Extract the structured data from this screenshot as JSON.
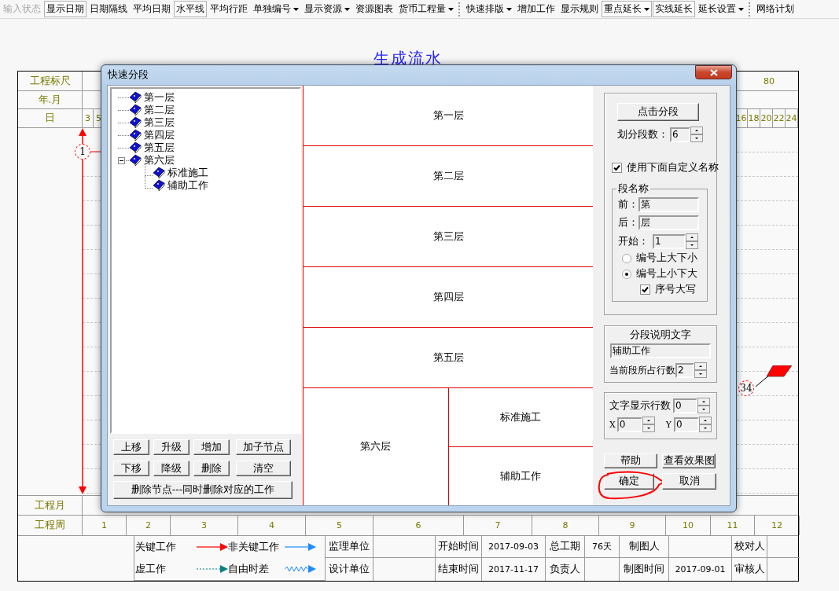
{
  "toolbar": {
    "groups": [
      {
        "items": [
          {
            "label": "输入状态",
            "kind": "button",
            "pressed": false,
            "disabled": true
          },
          {
            "label": "显示日期",
            "kind": "button",
            "pressed": true,
            "disabled": false
          },
          {
            "label": "日期隔线",
            "kind": "button",
            "pressed": false,
            "disabled": false
          },
          {
            "label": "平均日期",
            "kind": "button",
            "pressed": false,
            "disabled": false
          },
          {
            "label": "水平线",
            "kind": "button",
            "pressed": true,
            "disabled": false
          },
          {
            "label": "平均行距",
            "kind": "button",
            "pressed": false,
            "disabled": false
          },
          {
            "label": "单独编号",
            "kind": "dropdown",
            "pressed": false,
            "disabled": false
          },
          {
            "label": "显示资源",
            "kind": "dropdown",
            "pressed": false,
            "disabled": false
          },
          {
            "label": "资源图表",
            "kind": "button",
            "pressed": false,
            "disabled": false
          },
          {
            "label": "货币工程量",
            "kind": "dropdown",
            "pressed": false,
            "disabled": false
          }
        ]
      },
      {
        "items": [
          {
            "label": "快速排版",
            "kind": "dropdown",
            "pressed": false,
            "disabled": false
          },
          {
            "label": "增加工作",
            "kind": "button",
            "pressed": false,
            "disabled": false
          },
          {
            "label": "显示规则",
            "kind": "button",
            "pressed": false,
            "disabled": false
          },
          {
            "label": "重点延长",
            "kind": "dropdown",
            "pressed": true,
            "disabled": false
          },
          {
            "label": "实线延长",
            "kind": "button",
            "pressed": true,
            "disabled": false
          },
          {
            "label": "延长设置",
            "kind": "dropdown",
            "pressed": false,
            "disabled": false
          }
        ]
      },
      {
        "items": [
          {
            "label": "网络计划",
            "kind": "button",
            "pressed": false,
            "disabled": false
          }
        ]
      }
    ]
  },
  "chart": {
    "title": "生成流水",
    "scale_row": {
      "label": "工程标尺",
      "marks": [
        "80"
      ]
    },
    "month_row": {
      "label": "年.月"
    },
    "day_row": {
      "label": "日",
      "days_start": [
        "3",
        "5"
      ],
      "days_end": [
        "16",
        "18",
        "20",
        "22",
        "24"
      ]
    },
    "nodes": [
      {
        "number": "1",
        "kind": "start"
      },
      {
        "number": "34",
        "kind": "end"
      }
    ],
    "month_footer": {
      "label": "工程月"
    },
    "week_row": {
      "label": "工程周",
      "weeks": [
        "1",
        "2",
        "3",
        "4",
        "5",
        "6",
        "7",
        "8",
        "9",
        "10",
        "11",
        "12"
      ]
    }
  },
  "legend": [
    {
      "label": "关键工作",
      "kind": "critical"
    },
    {
      "label": "非关键工作",
      "kind": "noncritical"
    },
    {
      "label": "虚工作",
      "kind": "dummy"
    },
    {
      "label": "自由时差",
      "kind": "free_float"
    }
  ],
  "info_table": {
    "rows": [
      [
        "监理单位",
        null,
        "开始时间",
        "2017-09-03",
        "总工期",
        "76天",
        "制图人",
        null,
        "校对人",
        null
      ],
      [
        "设计单位",
        null,
        "结束时间",
        "2017-11-17",
        "负责人",
        null,
        "制图时间",
        "2017-09-01",
        "审核人",
        null
      ]
    ]
  },
  "dialog": {
    "title": "快速分段",
    "tree": [
      {
        "label": "第一层"
      },
      {
        "label": "第二层"
      },
      {
        "label": "第三层"
      },
      {
        "label": "第四层"
      },
      {
        "label": "第五层"
      },
      {
        "label": "第六层",
        "expanded": true,
        "children": [
          {
            "label": "标准施工"
          },
          {
            "label": "辅助工作"
          }
        ]
      }
    ],
    "tree_buttons": [
      [
        "上移",
        "升级",
        "增加",
        "加子节点"
      ],
      [
        "下移",
        "降级",
        "删除",
        "清空"
      ]
    ],
    "delete_button": "删除节点---同时删除对应的工作",
    "preview": [
      {
        "label": "第一层"
      },
      {
        "label": "第二层"
      },
      {
        "label": "第三层"
      },
      {
        "label": "第四层"
      },
      {
        "label": "第五层"
      },
      {
        "label": "第六层",
        "children": [
          {
            "label": "标准施工"
          },
          {
            "label": "辅助工作"
          }
        ]
      }
    ],
    "split_button": "点击分段",
    "segment_count": {
      "label": "划分段数：",
      "value": "6"
    },
    "use_custom_names": {
      "label": "使用下面自定义名称",
      "checked": true
    },
    "name_group": {
      "title": "段名称",
      "prefix": {
        "label": "前：",
        "value": "第"
      },
      "suffix": {
        "label": "后：",
        "value": "层"
      },
      "start": {
        "label": "开始：",
        "value": "1"
      },
      "order": [
        {
          "label": "编号上大下小",
          "selected": false
        },
        {
          "label": "编号上小下大",
          "selected": true
        }
      ],
      "uppercase": {
        "label": "序号大写",
        "checked": true
      }
    },
    "description": {
      "title": "分段说明文字",
      "value": "辅助工作",
      "rows_label": "当前段所占行数",
      "rows_value": "2"
    },
    "display": {
      "label": "文字显示行数",
      "value": "0",
      "x_label": "X",
      "x_value": "0",
      "y_label": "Y",
      "y_value": "0"
    },
    "buttons": [
      {
        "label": "帮助",
        "highlighted": false
      },
      {
        "label": "查看效果图",
        "highlighted": false
      },
      {
        "label": "确定",
        "highlighted": true
      },
      {
        "label": "取消",
        "highlighted": false
      }
    ]
  }
}
